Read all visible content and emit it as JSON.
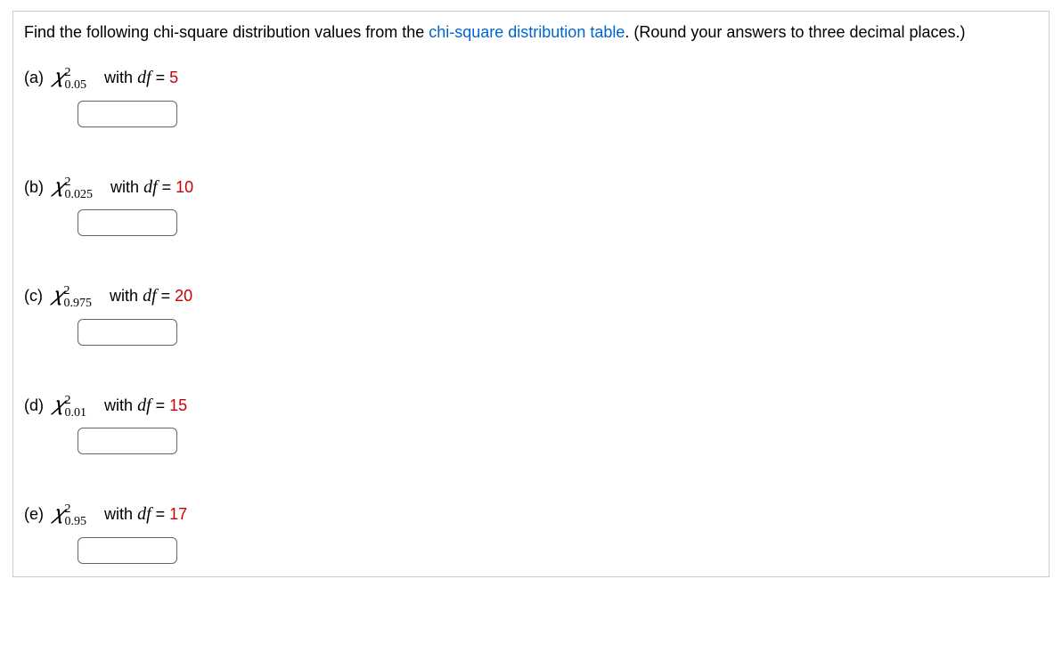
{
  "instructions": {
    "prefix": "Find the following chi-square distribution values from the ",
    "link": "chi-square distribution table",
    "suffix": ". (Round your answers to three decimal places.)"
  },
  "questions": [
    {
      "label": "(a)",
      "chi_base": "𝜒",
      "chi_sup": "2",
      "chi_sub": "0.05",
      "with": "with",
      "df_label": "df",
      "eq": " = ",
      "df_value": "5"
    },
    {
      "label": "(b)",
      "chi_base": "𝜒",
      "chi_sup": "2",
      "chi_sub": "0.025",
      "with": "with",
      "df_label": "df",
      "eq": " = ",
      "df_value": "10"
    },
    {
      "label": "(c)",
      "chi_base": "𝜒",
      "chi_sup": "2",
      "chi_sub": "0.975",
      "with": "with",
      "df_label": "df",
      "eq": " = ",
      "df_value": "20"
    },
    {
      "label": "(d)",
      "chi_base": "𝜒",
      "chi_sup": "2",
      "chi_sub": "0.01",
      "with": "with",
      "df_label": "df",
      "eq": " = ",
      "df_value": "15"
    },
    {
      "label": "(e)",
      "chi_base": "𝜒",
      "chi_sup": "2",
      "chi_sub": "0.95",
      "with": "with",
      "df_label": "df",
      "eq": " = ",
      "df_value": "17"
    }
  ]
}
